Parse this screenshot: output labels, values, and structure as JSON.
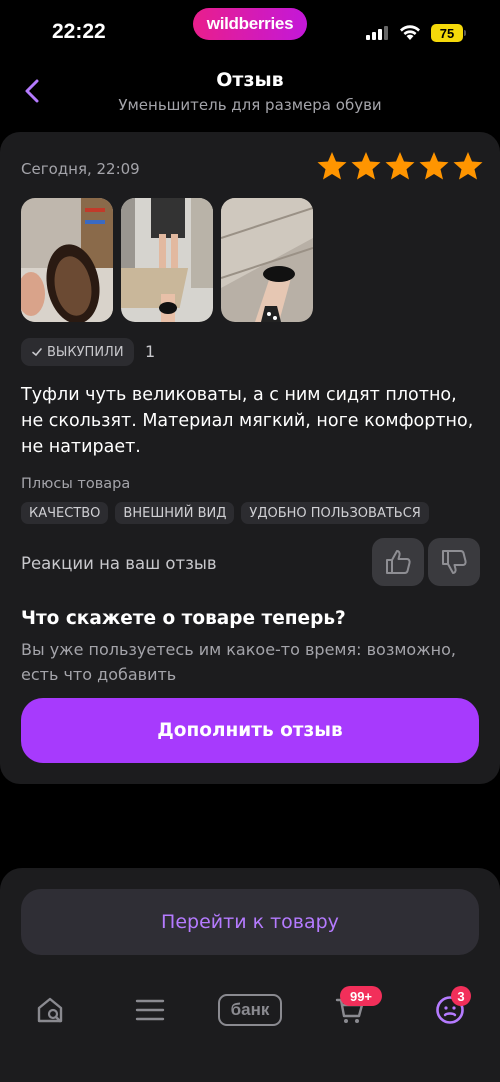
{
  "status_bar": {
    "time": "22:22",
    "brand": "wildberries",
    "battery": "75"
  },
  "header": {
    "title": "Отзыв",
    "subtitle": "Уменьшитель для размера обуви"
  },
  "review": {
    "date": "Сегодня, 22:09",
    "rating": 5,
    "rating_color": "#ff9500",
    "photos_count": 3,
    "bought_label": "ВЫКУПИЛИ",
    "bought_count": "1",
    "text": "Туфли чуть великоваты, а с ним сидят плотно, не скользят. Материал мягкий, ноге комфортно, не натирает.",
    "pros_label": "Плюсы товара",
    "tags": [
      "КАЧЕСТВО",
      "ВНЕШНИЙ ВИД",
      "УДОБНО ПОЛЬЗОВАТЬСЯ"
    ],
    "reactions_label": "Реакции на ваш отзыв"
  },
  "cta": {
    "title": "Что скажете о товаре теперь?",
    "subtitle": "Вы уже пользуетесь им какое-то время: возможно, есть что добавить",
    "button": "Дополнить отзыв",
    "accent": "#a73afd"
  },
  "bottom": {
    "go_to_product": "Перейти к товару",
    "tabs": {
      "home_icon": "home-search-icon",
      "catalog_icon": "menu-icon",
      "bank": "банк",
      "cart_badge": "99+",
      "profile_badge": "3"
    }
  }
}
